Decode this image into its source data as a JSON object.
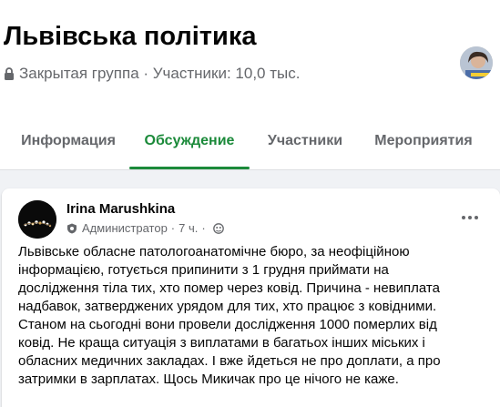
{
  "group": {
    "title": "Львівська політика",
    "meta": "Закрытая группа · Участники: 10,0 тыс."
  },
  "tabs": [
    {
      "label": "Информация",
      "active": false
    },
    {
      "label": "Обсуждение",
      "active": true
    },
    {
      "label": "Участники",
      "active": false
    },
    {
      "label": "Мероприятия",
      "active": false
    }
  ],
  "post": {
    "author": "Irina Marushkina",
    "role": "Администратор",
    "time": "7 ч.",
    "lines": [
      "Львівське обласне патологоанатомічне бюро, за неофіційною",
      "інформацією, готується припинити з 1 грудня приймати на",
      "дослідження тіла тих, хто помер через ковід.  Причина  - невиплата",
      "надбавок, затверджених урядом для тих, хто працює з ковідними.",
      "Станом на сьогодні вони провели дослідження 1000 померлих від",
      "ковід. Не краща ситуація з виплатами в багатьох інших міських і",
      "обласних медичних закладах. І вже йдеться не про доплати, а про",
      "затримки в зарплатах.  Щось Микичак про це нічого не каже."
    ]
  },
  "colors": {
    "accent": "#1b8a3a",
    "secondary_text": "#65676b",
    "background": "#f0f2f5"
  },
  "icons": {
    "lock": "lock-icon",
    "admin": "admin-badge-icon",
    "audience": "globe-icon",
    "more": "more-options-icon"
  }
}
